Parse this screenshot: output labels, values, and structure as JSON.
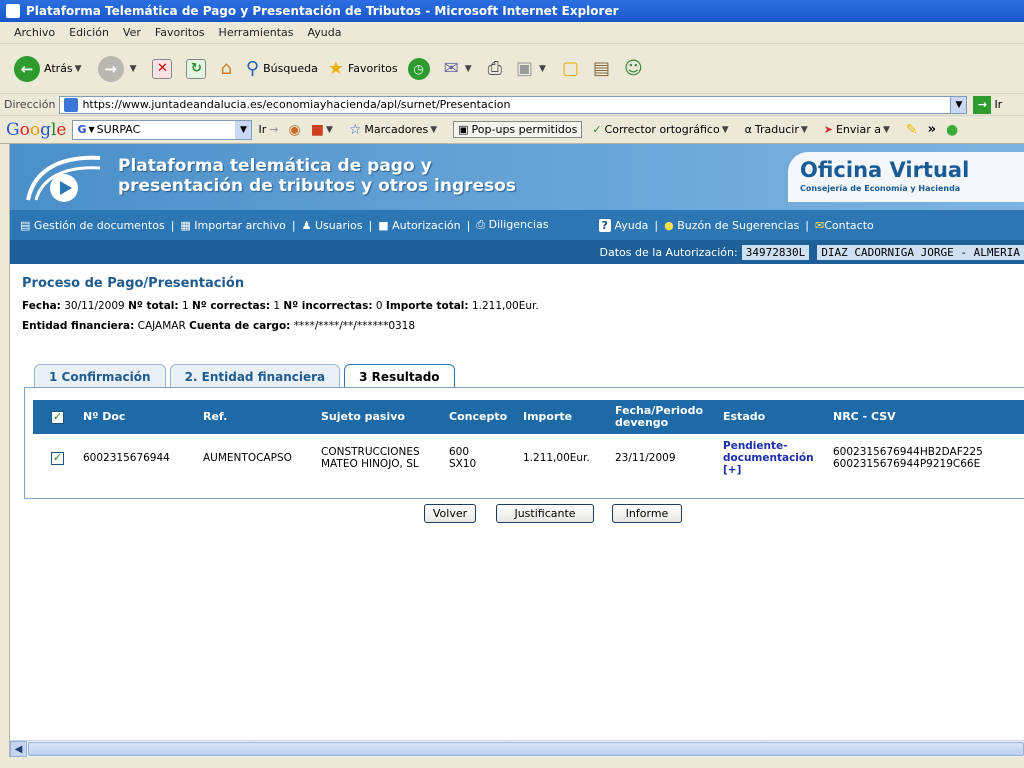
{
  "window": {
    "title": "Plataforma Telemática de Pago y Presentación de Tributos - Microsoft Internet Explorer"
  },
  "menu": [
    "Archivo",
    "Edición",
    "Ver",
    "Favoritos",
    "Herramientas",
    "Ayuda"
  ],
  "toolbar": {
    "back_label": "Atrás",
    "search_label": "Búsqueda",
    "favorites_label": "Favoritos"
  },
  "address": {
    "label": "Dirección",
    "url": "https://www.juntadeandalucia.es/economiayhacienda/apl/surnet/Presentacion",
    "go_label": "Ir"
  },
  "google_toolbar": {
    "search_value": "SURPAC",
    "go_label": "Ir",
    "bookmarks_label": "Marcadores",
    "popups_label": "Pop-ups permitidos",
    "spell_label": "Corrector ortográfico",
    "translate_label": "Traducir",
    "send_label": "Enviar a",
    "more_label": "»"
  },
  "banner": {
    "line1": "Plataforma telemática de pago y",
    "line2": "presentación de tributos y otros ingresos",
    "office_title": "Oficina Virtual",
    "office_subtitle": "Consejería de Economía y Hacienda"
  },
  "nav": {
    "items": [
      "Gestión de documentos",
      "Importar archivo",
      "Usuarios",
      "Autorización",
      "Diligencias"
    ],
    "help": "Ayuda",
    "suggestions": "Buzón de Sugerencias",
    "contact": "Contacto"
  },
  "auth": {
    "label": "Datos de la Autorización:",
    "id": "34972830L",
    "name": "DIAZ CADORNIGA JORGE - ALMERIA"
  },
  "process": {
    "title": "Proceso de Pago/Presentación",
    "fecha_label": "Fecha:",
    "fecha": "30/11/2009",
    "total_label": "Nº total:",
    "total": "1",
    "correctas_label": "Nº correctas:",
    "correctas": "1",
    "incorrectas_label": "Nº incorrectas:",
    "incorrectas": "0",
    "importe_label": "Importe total:",
    "importe": "1.211,00Eur.",
    "entidad_label": "Entidad financiera:",
    "entidad": "CAJAMAR",
    "cuenta_label": "Cuenta de cargo:",
    "cuenta": "****/****/**/******0318"
  },
  "tabs": [
    "1 Confirmación",
    "2. Entidad financiera",
    "3 Resultado"
  ],
  "table": {
    "headers": {
      "doc": "Nº Doc",
      "ref": "Ref.",
      "sujeto": "Sujeto pasivo",
      "concepto": "Concepto",
      "importe": "Importe",
      "fecha": "Fecha/Periodo devengo",
      "estado": "Estado",
      "nrc": "NRC - CSV"
    },
    "rows": [
      {
        "doc": "6002315676944",
        "ref": "AUMENTOCAPSO",
        "sujeto": "CONSTRUCCIONES MATEO HINOJO, SL",
        "concepto": "600 SX10",
        "importe": "1.211,00Eur.",
        "fecha": "23/11/2009",
        "estado": "Pendiente-documentación [+]",
        "nrc1": "6002315676944HB2DAF225",
        "nrc2": "6002315676944P9219C66E"
      }
    ]
  },
  "buttons": {
    "volver": "Volver",
    "justificante": "Justificante",
    "informe": "Informe"
  }
}
